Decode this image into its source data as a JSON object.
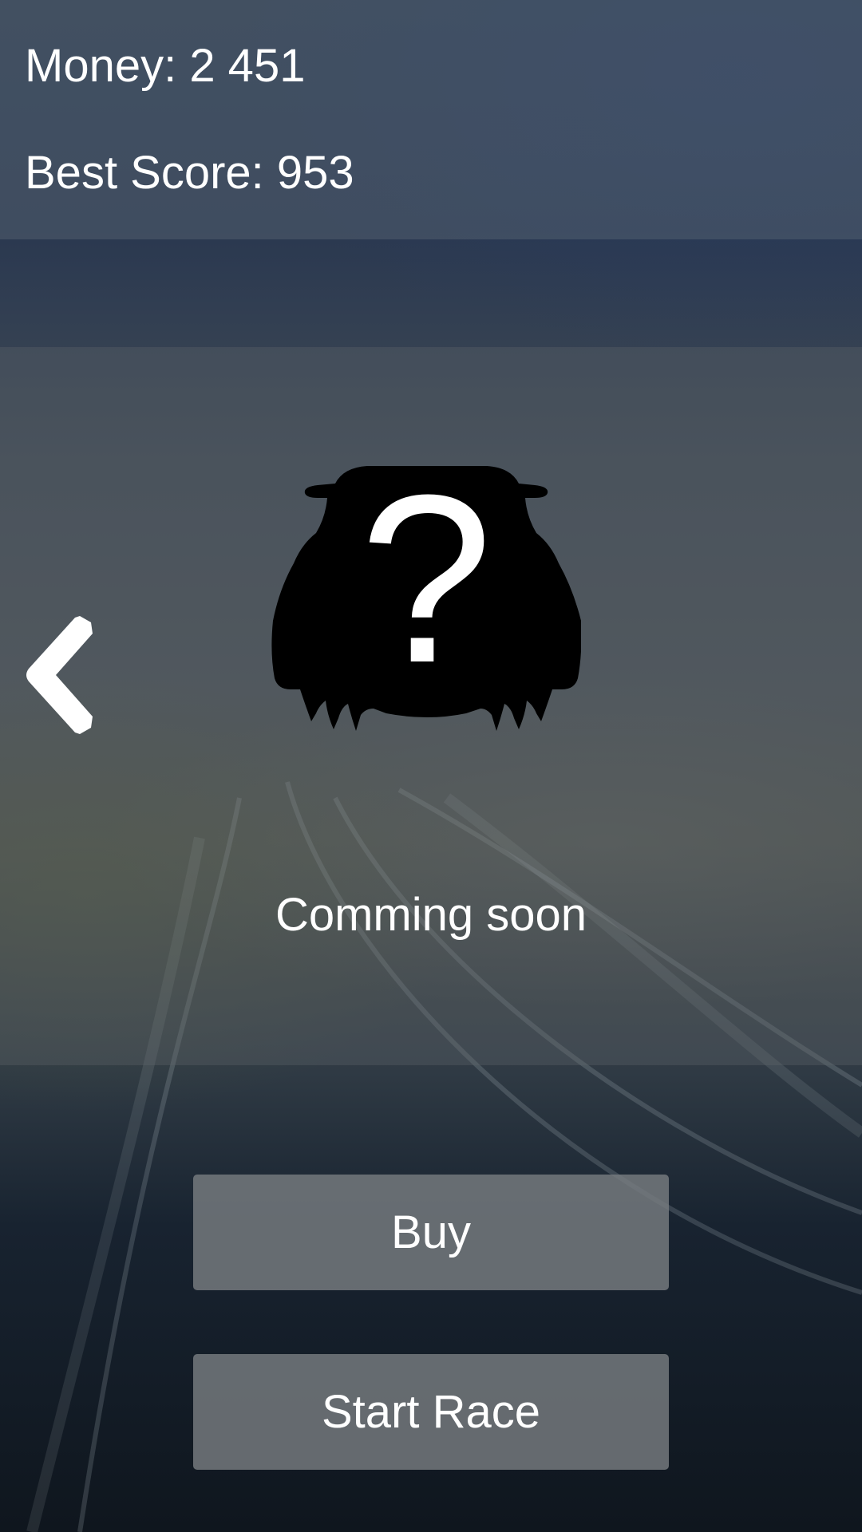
{
  "stats": {
    "money": "Money: 2 451",
    "best_score": "Best Score: 953"
  },
  "car_preview": {
    "icon": "locked-car-silhouette-icon",
    "glyph": "?",
    "status": "Comming soon"
  },
  "navigation": {
    "previous_icon": "chevron-left-icon"
  },
  "buttons": {
    "buy": "Buy",
    "start_race": "Start Race"
  },
  "colors": {
    "text": "#ffffff",
    "button_bg": "#787c80",
    "car_silhouette": "#000000"
  }
}
